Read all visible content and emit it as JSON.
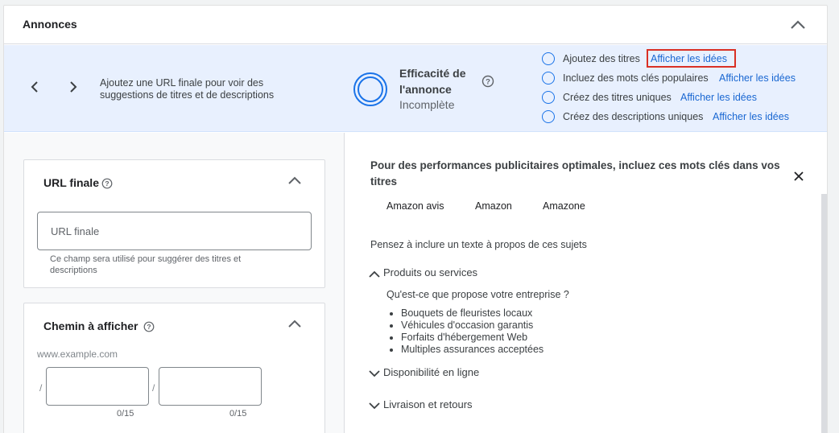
{
  "card": {
    "title": "Annonces"
  },
  "banner": {
    "message": "Ajoutez une URL finale pour voir des suggestions de titres et de descriptions",
    "strength_title": "Efficacité de l'annonce",
    "strength_status": "Incomplète",
    "checklist": [
      {
        "label": "Ajoutez des titres",
        "link": "Afficher les idées",
        "highlighted": true
      },
      {
        "label": "Incluez des mots clés populaires",
        "link": "Afficher les idées"
      },
      {
        "label": "Créez des titres uniques",
        "link": "Afficher les idées"
      },
      {
        "label": "Créez des descriptions uniques",
        "link": "Afficher les idées"
      }
    ]
  },
  "url_card": {
    "title": "URL finale",
    "placeholder": "URL finale",
    "hint": "Ce champ sera utilisé pour suggérer des titres et descriptions"
  },
  "path_card": {
    "title": "Chemin à afficher",
    "domain": "www.example.com",
    "slash": "/",
    "counter1": "0/15",
    "counter2": "0/15"
  },
  "ideas": {
    "heading": "Pour des performances publicitaires optimales, incluez ces mots clés dans vos titres",
    "keywords": [
      "Amazon avis",
      "Amazon",
      "Amazone"
    ],
    "subheading": "Pensez à inclure un texte à propos de ces sujets",
    "sections": [
      {
        "title": "Produits ou services",
        "expanded": true
      },
      {
        "title": "Disponibilité en ligne",
        "expanded": false
      },
      {
        "title": "Livraison et retours",
        "expanded": false
      }
    ],
    "question": "Qu'est-ce que propose votre entreprise ?",
    "bullets": [
      "Bouquets de fleuristes locaux",
      "Véhicules d'occasion garantis",
      "Forfaits d'hébergement Web",
      "Multiples assurances acceptées"
    ]
  },
  "colors": {
    "accent": "#1a73e8",
    "link": "#1967d2",
    "banner_bg": "#e8f0fe",
    "highlight": "#d93025"
  }
}
